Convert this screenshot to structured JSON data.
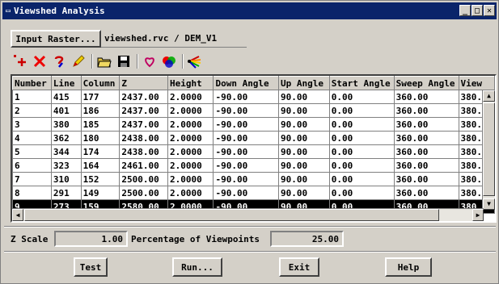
{
  "window": {
    "title": "Viewshed Analysis",
    "sys_glyph": "▭",
    "min_glyph": "_",
    "max_glyph": "□",
    "close_glyph": "✕"
  },
  "input": {
    "button_label": "Input Raster...",
    "raster_path": "viewshed.rvc / DEM_V1"
  },
  "toolbar": {
    "icons": [
      "add-point-icon",
      "delete-icon",
      "query-icon",
      "pencil-icon",
      "open-folder-icon",
      "save-icon",
      "heart-icon",
      "rgb-icon",
      "fan-icon"
    ]
  },
  "table": {
    "columns": [
      "Number",
      "Line",
      "Column",
      "Z",
      "Height",
      "Down Angle",
      "Up Angle",
      "Start Angle",
      "Sweep Angle",
      "View"
    ],
    "rows": [
      [
        "1",
        "415",
        "177",
        "2437.00",
        "2.0000",
        "-90.00",
        "90.00",
        "0.00",
        "360.00",
        "380."
      ],
      [
        "2",
        "401",
        "186",
        "2437.00",
        "2.0000",
        "-90.00",
        "90.00",
        "0.00",
        "360.00",
        "380."
      ],
      [
        "3",
        "380",
        "185",
        "2437.00",
        "2.0000",
        "-90.00",
        "90.00",
        "0.00",
        "360.00",
        "380."
      ],
      [
        "4",
        "362",
        "180",
        "2438.00",
        "2.0000",
        "-90.00",
        "90.00",
        "0.00",
        "360.00",
        "380."
      ],
      [
        "5",
        "344",
        "174",
        "2438.00",
        "2.0000",
        "-90.00",
        "90.00",
        "0.00",
        "360.00",
        "380."
      ],
      [
        "6",
        "323",
        "164",
        "2461.00",
        "2.0000",
        "-90.00",
        "90.00",
        "0.00",
        "360.00",
        "380."
      ],
      [
        "7",
        "310",
        "152",
        "2500.00",
        "2.0000",
        "-90.00",
        "90.00",
        "0.00",
        "360.00",
        "380."
      ],
      [
        "8",
        "291",
        "149",
        "2500.00",
        "2.0000",
        "-90.00",
        "90.00",
        "0.00",
        "360.00",
        "380."
      ],
      [
        "9",
        "273",
        "159",
        "2580.00",
        "2.0000",
        "-90.00",
        "90.00",
        "0.00",
        "360.00",
        "380."
      ]
    ],
    "selected_row": 9
  },
  "settings": {
    "z_scale_label": "Z Scale",
    "z_scale_value": "1.00",
    "percentage_label": "Percentage of Viewpoints",
    "percentage_value": "25.00"
  },
  "buttons": {
    "test": "Test",
    "run": "Run...",
    "exit": "Exit",
    "help": "Help"
  }
}
